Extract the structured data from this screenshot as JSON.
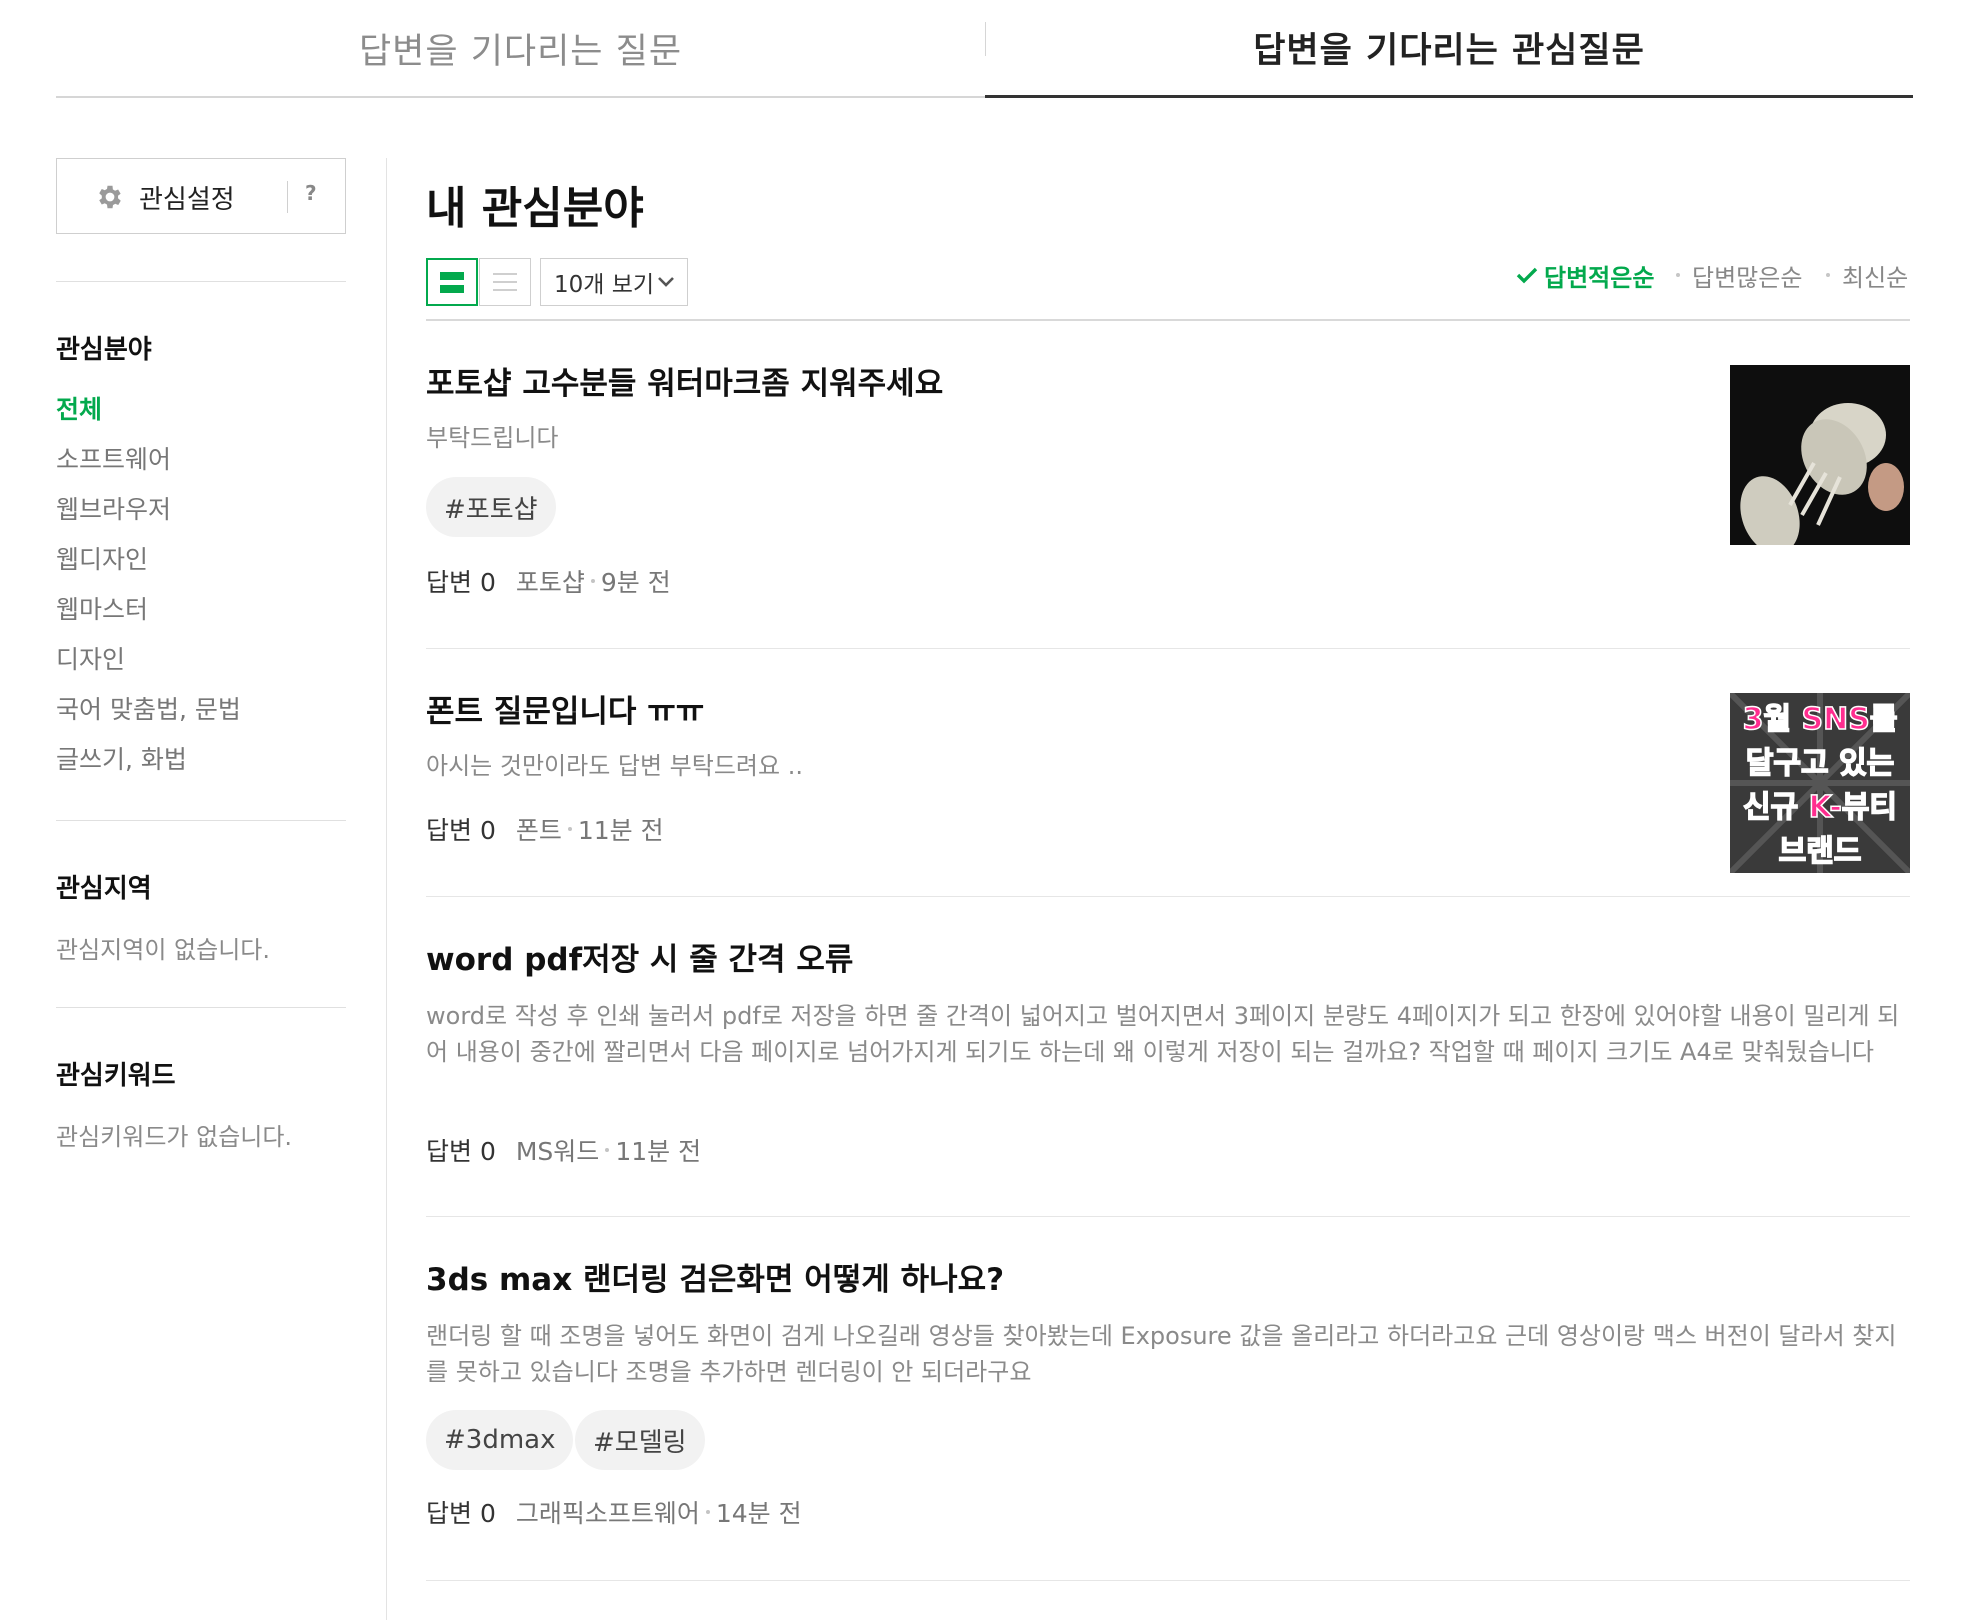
{
  "tabs": {
    "waiting": "답변을 기다리는 질문",
    "waiting_interest": "답변을 기다리는 관심질문"
  },
  "sidebar": {
    "setting_label": "관심설정",
    "help": "?",
    "interest_field_heading": "관심분야",
    "items": [
      "전체",
      "소프트웨어",
      "웹브라우저",
      "웹디자인",
      "웹마스터",
      "디자인",
      "국어 맞춤법, 문법",
      "글쓰기, 화법"
    ],
    "region_heading": "관심지역",
    "region_empty": "관심지역이 없습니다.",
    "keyword_heading": "관심키워드",
    "keyword_empty": "관심키워드가 없습니다."
  },
  "main": {
    "title": "내 관심분야",
    "per_page": "10개 보기",
    "sort": [
      "답변적은순",
      "답변많은순",
      "최신순"
    ]
  },
  "questions": [
    {
      "title": "포토샵 고수분들 워터마크좀 지워주세요",
      "desc": "부탁드립니다",
      "tags": [
        "#포토샵"
      ],
      "answers": "답변 0",
      "category": "포토샵",
      "time": "9분 전"
    },
    {
      "title": "폰트 질문입니다 ㅠㅠ",
      "desc": "아시는 것만이라도 답변 부탁드려요 ..",
      "tags": [],
      "answers": "답변 0",
      "category": "폰트",
      "time": "11분 전",
      "thumb_text": [
        "3월 SNS를",
        "달구고 있는",
        "신규 K-뷰티",
        "브랜드"
      ]
    },
    {
      "title": "word pdf저장 시 줄 간격 오류",
      "desc": "word로 작성 후 인쇄 눌러서 pdf로 저장을 하면 줄 간격이 넓어지고 벌어지면서 3페이지 분량도 4페이지가 되고 한장에 있어야할 내용이 밀리게 되어 내용이 중간에 짤리면서 다음 페이지로 넘어가지게 되기도 하는데 왜 이렇게 저장이 되는 걸까요? 작업할 때 페이지 크기도 A4로 맞춰뒀습니다",
      "tags": [],
      "answers": "답변 0",
      "category": "MS워드",
      "time": "11분 전"
    },
    {
      "title": "3ds max 랜더링 검은화면 어떻게 하나요?",
      "desc": "랜더링 할 때 조명을 넣어도 화면이 검게 나오길래 영상들 찾아봤는데 Exposure 값을 올리라고 하더라고요 근데 영상이랑 맥스 버전이 달라서 찾지를 못하고 있습니다 조명을 추가하면 렌더링이 안 되더라구요",
      "tags": [
        "#3dmax",
        "#모델링"
      ],
      "answers": "답변 0",
      "category": "그래픽소프트웨어",
      "time": "14분 전"
    }
  ],
  "colors": {
    "accent": "#03a94d",
    "thumb_text_pink": "#ff2d8f"
  }
}
